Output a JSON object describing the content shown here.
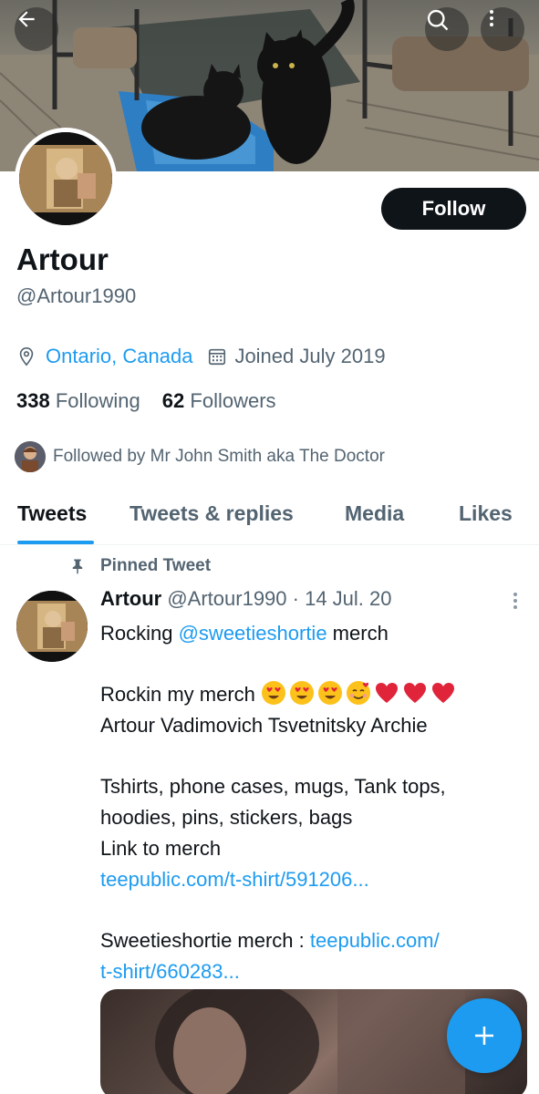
{
  "header": {
    "back_icon": "arrow-left-icon",
    "search_icon": "search-icon",
    "more_icon": "more-vertical-icon"
  },
  "profile": {
    "display_name": "Artour",
    "handle": "@Artour1990",
    "follow_label": "Follow",
    "location": "Ontario, Canada",
    "joined": "Joined July 2019",
    "following_count": "338",
    "following_label": "Following",
    "followers_count": "62",
    "followers_label": "Followers",
    "followed_by": "Followed by Mr John Smith aka The Doctor"
  },
  "tabs": [
    {
      "label": "Tweets",
      "active": true
    },
    {
      "label": "Tweets & replies",
      "active": false
    },
    {
      "label": "Media",
      "active": false
    },
    {
      "label": "Likes",
      "active": false
    }
  ],
  "tweet": {
    "pinned_label": "Pinned Tweet",
    "author": "Artour",
    "handle_date": "@Artour1990 · 14 Jul. 20",
    "line1_prefix": "Rocking ",
    "line1_mention": "@sweetieshortie",
    "line1_suffix": " merch",
    "line2": "Rockin my merch ",
    "emojis": [
      "😍",
      "😍",
      "😍",
      "🥰",
      "❤️",
      "❤️",
      "❤️"
    ],
    "line3": "Artour Vadimovich Tsvetnitsky Archie",
    "line4": " Tshirts, phone cases, mugs, Tank tops,",
    "line5": "hoodies, pins, stickers, bags",
    "line6": "Link to merch",
    "link1": "teepublic.com/t-shirt/591206...",
    "line7_prefix": "Sweetieshortie merch : ",
    "link2_part1": "teepublic.com/",
    "link2_part2": "t-shirt/660283..."
  },
  "colors": {
    "accent": "#1d9bf0",
    "text": "#0f1419",
    "muted": "#536471",
    "follow_bg": "#0f1419"
  }
}
